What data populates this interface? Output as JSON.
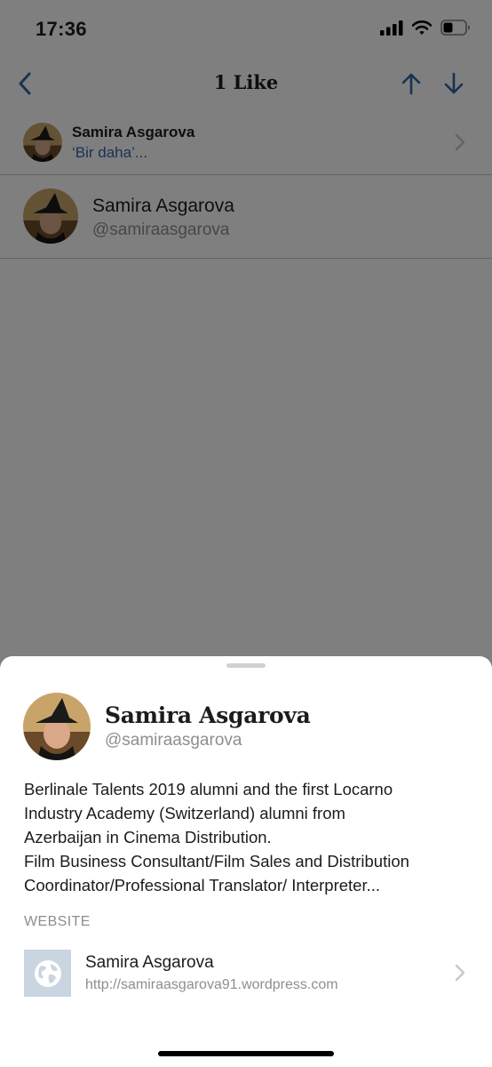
{
  "status_bar": {
    "time": "17:36",
    "icons": [
      "cellular-signal-icon",
      "wifi-icon",
      "battery-icon"
    ]
  },
  "nav": {
    "title": "1 Like",
    "back_icon": "chevron-left-icon",
    "up_icon": "arrow-up-icon",
    "down_icon": "arrow-down-icon"
  },
  "story": {
    "author": "Samira Asgarova",
    "snippet": "‘Bir daha’...",
    "chevron_icon": "chevron-right-icon"
  },
  "likers": [
    {
      "name": "Samira Asgarova",
      "handle": "@samiraasgarova"
    }
  ],
  "profile_sheet": {
    "name": "Samira Asgarova",
    "handle": "@samiraasgarova",
    "bio_lines": [
      "Berlinale Talents 2019 alumni and the first Locarno",
      "Industry Academy (Switzerland) alumni from",
      "Azerbaijan in Cinema Distribution.",
      "Film Business Consultant/Film Sales and Distribution",
      "Coordinator/Professional Translator/ Interpreter..."
    ],
    "website_header": "WEBSITE",
    "website": {
      "title": "Samira Asgarova",
      "url": "http://samiraasgarova91.wordpress.com",
      "thumb_icon": "wordpress-globe-icon",
      "chevron_icon": "chevron-right-icon"
    }
  },
  "colors": {
    "accent_blue": "#2f67a8",
    "secondary_text": "#8e8e93",
    "overlay": "rgba(0,0,0,0.5)"
  }
}
